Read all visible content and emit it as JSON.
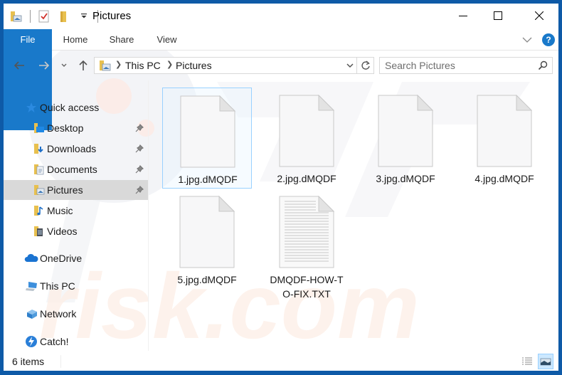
{
  "window": {
    "title": "Pictures",
    "controls": {
      "minimize": "minimize",
      "maximize": "maximize",
      "close": "close"
    }
  },
  "quick_access_toolbar": {
    "icons": [
      "folder-pictures-icon",
      "properties-checkmark-icon",
      "new-folder-icon",
      "customize-dropdown-icon"
    ]
  },
  "ribbon": {
    "tabs": [
      {
        "label": "File",
        "active": true
      },
      {
        "label": "Home"
      },
      {
        "label": "Share"
      },
      {
        "label": "View"
      }
    ],
    "help_label": "?"
  },
  "address_bar": {
    "breadcrumb": [
      "This PC",
      "Pictures"
    ],
    "refresh_icon": "refresh-icon"
  },
  "search": {
    "placeholder": "Search Pictures",
    "value": ""
  },
  "nav_pane": {
    "items": [
      {
        "label": "Quick access",
        "icon": "star-icon"
      },
      {
        "label": "Desktop",
        "icon": "desktop-folder-icon",
        "pinned": true
      },
      {
        "label": "Downloads",
        "icon": "downloads-folder-icon",
        "pinned": true
      },
      {
        "label": "Documents",
        "icon": "documents-folder-icon",
        "pinned": true
      },
      {
        "label": "Pictures",
        "icon": "pictures-folder-icon",
        "pinned": true,
        "selected": true
      },
      {
        "label": "Music",
        "icon": "music-folder-icon"
      },
      {
        "label": "Videos",
        "icon": "videos-folder-icon"
      },
      {
        "label": "OneDrive",
        "icon": "onedrive-cloud-icon"
      },
      {
        "label": "This PC",
        "icon": "computer-icon"
      },
      {
        "label": "Network",
        "icon": "network-icon"
      },
      {
        "label": "Catch!",
        "icon": "catch-bolt-icon"
      }
    ]
  },
  "files": [
    {
      "name": "1.jpg.dMQDF",
      "type": "blank",
      "selected": true
    },
    {
      "name": "2.jpg.dMQDF",
      "type": "blank"
    },
    {
      "name": "3.jpg.dMQDF",
      "type": "blank"
    },
    {
      "name": "4.jpg.dMQDF",
      "type": "blank"
    },
    {
      "name": "5.jpg.dMQDF",
      "type": "blank"
    },
    {
      "name": "DMQDF-HOW-TO-FIX.TXT",
      "name_line1": "DMQDF-HOW-T",
      "name_line2": "O-FIX.TXT",
      "type": "text"
    }
  ],
  "status_bar": {
    "item_count": "6 items",
    "views": [
      "details-view",
      "large-icons-view"
    ]
  },
  "colors": {
    "accent": "#1979ca",
    "frame": "#0e5aa7",
    "selection": "#cce8ff",
    "selection_border": "#99d1ff",
    "nav_selected": "#d9d9d9"
  }
}
